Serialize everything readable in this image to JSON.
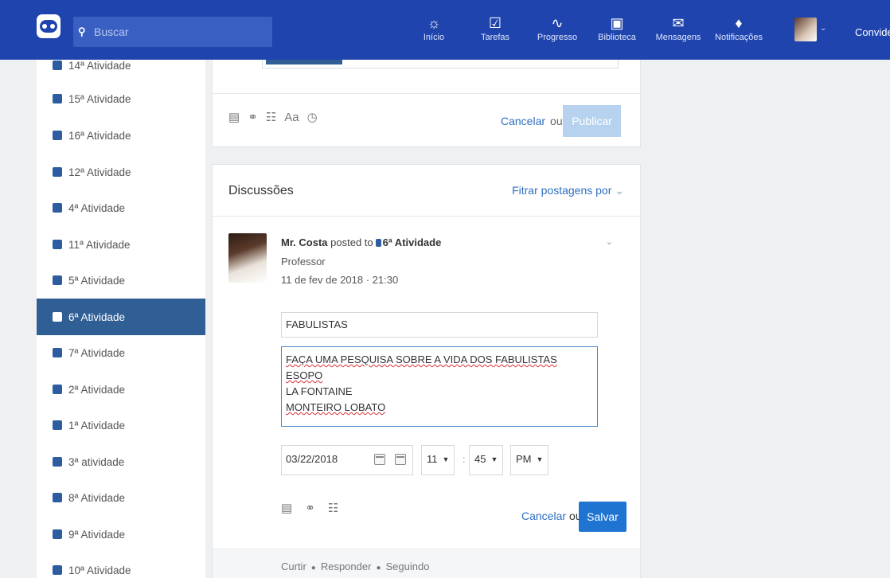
{
  "topbar": {
    "search_placeholder": "Buscar",
    "nav": [
      {
        "label": "Início",
        "icon": "home-icon"
      },
      {
        "label": "Tarefas",
        "icon": "checkbox-icon"
      },
      {
        "label": "Progresso",
        "icon": "pulse-icon"
      },
      {
        "label": "Biblioteca",
        "icon": "library-icon"
      },
      {
        "label": "Mensagens",
        "icon": "message-icon"
      },
      {
        "label": "Notificações",
        "icon": "bell-icon"
      }
    ],
    "user_name": "Convidel"
  },
  "sidebar": {
    "items": [
      {
        "label": "14ª Atividade"
      },
      {
        "label": "15ª Atividade"
      },
      {
        "label": "16ª Atividade"
      },
      {
        "label": "12ª Atividade"
      },
      {
        "label": "4ª Atividade"
      },
      {
        "label": "11ª Atividade"
      },
      {
        "label": "5ª Atividade"
      },
      {
        "label": "6ª Atividade",
        "active": true
      },
      {
        "label": "7ª Atividade"
      },
      {
        "label": "2ª Atividade"
      },
      {
        "label": "1ª Atividade"
      },
      {
        "label": "3ª atividade"
      },
      {
        "label": "8ª Atividade"
      },
      {
        "label": "9ª Atividade"
      },
      {
        "label": "10ª Atividade"
      }
    ]
  },
  "composer": {
    "text_style_label": "Aa",
    "cancel_label": "Cancelar",
    "or_label": "ou",
    "publish_label": "Publicar"
  },
  "discussion": {
    "title": "Discussões",
    "filter_label": "Fitrar postagens por",
    "post": {
      "author": "Mr. Costa",
      "posted_to": "posted to",
      "group": "6ª Atividade",
      "role": "Professor",
      "date": "11 de fev de 2018 · 21:30"
    },
    "edit": {
      "title_value": "FABULISTAS",
      "body_lines": [
        "FAÇA UMA PESQUISA SOBRE A VIDA DOS FABULISTAS",
        "ESOPO",
        "LA FONTAINE",
        "MONTEIRO LOBATO"
      ],
      "date_value": "03/22/2018",
      "hour": "11",
      "minute": "45",
      "ampm": "PM",
      "cancel_label": "Cancelar",
      "or_label": "ou",
      "save_label": "Salvar"
    },
    "footer": {
      "like": "Curtir",
      "reply": "Responder",
      "following": "Seguindo"
    }
  },
  "colors": {
    "topbar": "#1f44ad",
    "active_sidebar": "#2f5f95",
    "link": "#2f6fc0",
    "save_button": "#1f74d1",
    "publish_disabled": "#b7d2ef"
  }
}
